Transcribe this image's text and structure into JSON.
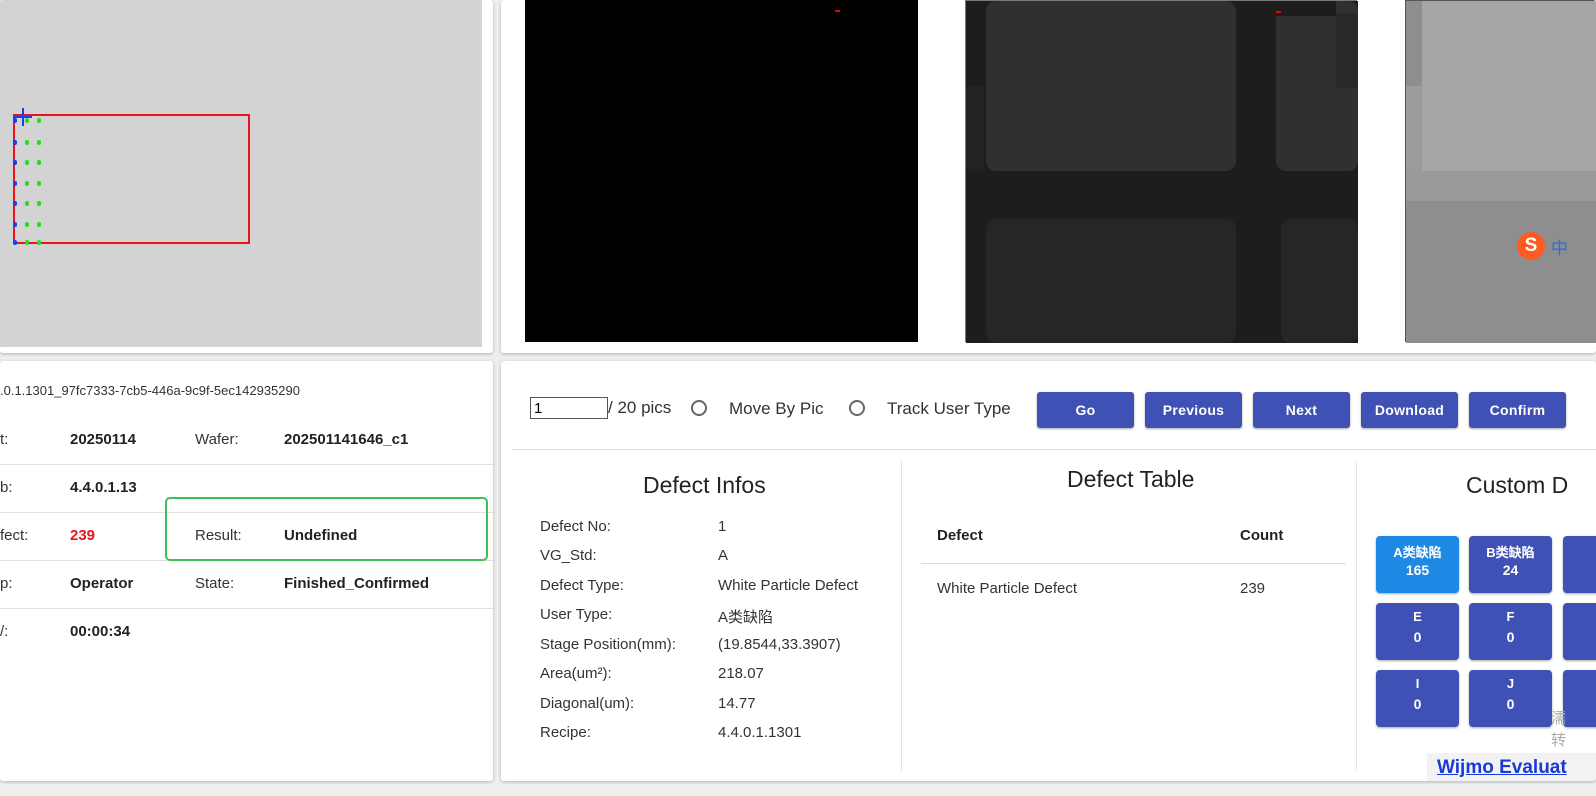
{
  "map": {
    "colors": {
      "background": "#d3d3d3",
      "die_border": "#e8141b",
      "dot_green": "#22dd22",
      "dot_blue": "#1e3cf0",
      "crosshair": "#1e3cf0"
    }
  },
  "images": {
    "labels": []
  },
  "sogou": {
    "logo_char": "S",
    "zh_char": "中"
  },
  "info": {
    "session_id": ".0.1.1301_97fc7333-7cb5-446a-9c9f-5ec142935290",
    "rows": [
      {
        "left_key": "t:",
        "left_value": "20250114",
        "right_key": "Wafer:",
        "right_value": "202501141646_c1"
      },
      {
        "left_key": "b:",
        "left_value": "4.4.0.1.13",
        "right_key": "",
        "right_value": ""
      },
      {
        "left_key": "fect:",
        "left_value": "239",
        "right_key": "Result:",
        "right_value": "Undefined"
      },
      {
        "left_key": "p:",
        "left_value": "Operator",
        "right_key": "State:",
        "right_value": "Finished_Confirmed"
      },
      {
        "left_key": "/:",
        "left_value": "00:00:34",
        "right_key": "",
        "right_value": ""
      }
    ],
    "defect_count_color": "#e8141b",
    "highlight_color": "#3cc05b"
  },
  "controls": {
    "page_value": "1",
    "page_total": "/ 20 pics",
    "radio_move": "Move By Pic",
    "radio_track": "Track User Type",
    "buttons": {
      "go": "Go",
      "previous": "Previous",
      "next": "Next",
      "download": "Download",
      "confirm": "Confirm"
    },
    "button_color": "#3f51b5"
  },
  "defect_infos": {
    "title": "Defect Infos",
    "items": [
      {
        "key": "Defect No:",
        "value": "1"
      },
      {
        "key": "VG_Std:",
        "value": "A"
      },
      {
        "key": "Defect Type:",
        "value": "White Particle Defect"
      },
      {
        "key": "User Type:",
        "value": "A类缺陷"
      },
      {
        "key": "Stage Position(mm):",
        "value": "(19.8544,33.3907)"
      },
      {
        "key": "Area(um²):",
        "value": "218.07"
      },
      {
        "key": "Diagonal(um):",
        "value": "14.77"
      },
      {
        "key": "Recipe:",
        "value": "4.4.0.1.1301"
      }
    ]
  },
  "defect_table": {
    "title": "Defect Table",
    "headers": {
      "defect": "Defect",
      "count": "Count"
    },
    "rows": [
      {
        "defect": "White Particle Defect",
        "count": "239"
      }
    ]
  },
  "custom": {
    "title": "Custom D",
    "buttons": [
      {
        "label": "A类缺陷",
        "count": "165",
        "active": true
      },
      {
        "label": "B类缺陷",
        "count": "24",
        "active": false
      },
      {
        "label": "E",
        "count": "0",
        "active": false
      },
      {
        "label": "F",
        "count": "0",
        "active": false
      },
      {
        "label": "I",
        "count": "0",
        "active": false
      },
      {
        "label": "J",
        "count": "0",
        "active": false
      }
    ],
    "active_color": "#1e88e5"
  },
  "overlay": {
    "wijmo_text": "Wijmo Evaluat",
    "watermark_1": "濡",
    "watermark_2": "转"
  }
}
